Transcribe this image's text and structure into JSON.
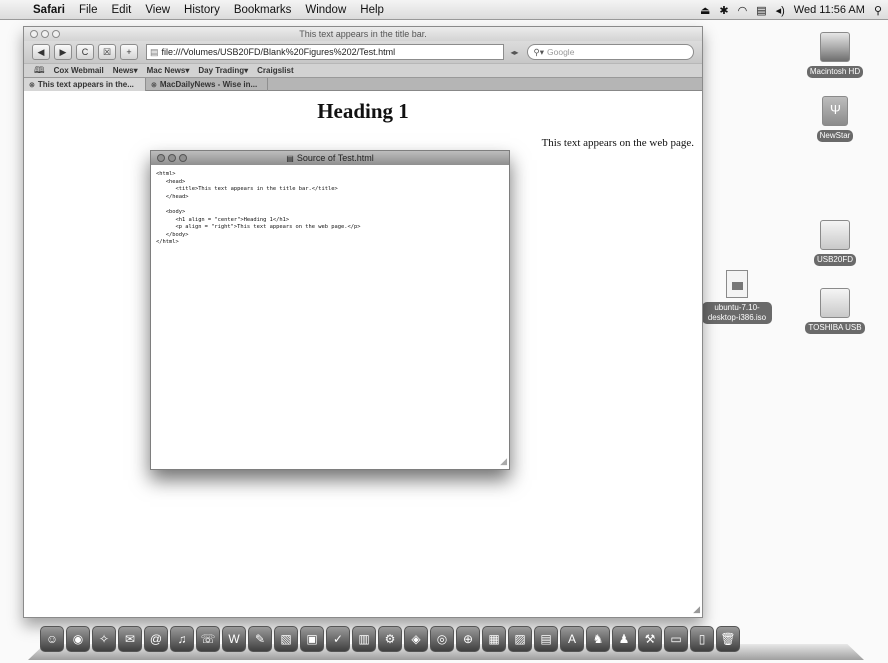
{
  "menubar": {
    "app": "Safari",
    "items": [
      "File",
      "Edit",
      "View",
      "History",
      "Bookmarks",
      "Window",
      "Help"
    ],
    "clock": "Wed 11:56 AM"
  },
  "safari": {
    "title": "This text appears in the title bar.",
    "toolbar": {
      "back": "◀",
      "forward": "▶",
      "reload": "C",
      "stop": "☒",
      "add": "+",
      "address": "file:///Volumes/USB20FD/Blank%20Figures%202/Test.html",
      "search_placeholder": "Google"
    },
    "bookmarks": [
      "Cox Webmail",
      "News▾",
      "Mac News▾",
      "Day Trading▾",
      "Craigslist"
    ],
    "tabs": [
      "This text appears in the...",
      "MacDailyNews - Wise in..."
    ],
    "page": {
      "heading": "Heading 1",
      "paragraph": "This text appears on the web page."
    }
  },
  "source_window": {
    "title": "Source of Test.html",
    "lines": [
      "<html>",
      "   <head>",
      "      <title>This text appears in the title bar.</title>",
      "   </head>",
      "",
      "   <body>",
      "      <h1 align = \"center\">Heading 1</h1>",
      "      <p align = \"right\">This text appears on the web page.</p>",
      "   </body>",
      "</html>"
    ]
  },
  "desktop": {
    "icons": [
      {
        "label": "Macintosh HD",
        "kind": "hard-drive"
      },
      {
        "label": "NewStar",
        "kind": "usb-drive"
      },
      {
        "label": "USB20FD",
        "kind": "external-drive"
      },
      {
        "label": "ubuntu-7.10-desktop-i386.iso",
        "kind": "disk-image"
      },
      {
        "label": "TOSHIBA USB",
        "kind": "external-drive"
      }
    ]
  }
}
